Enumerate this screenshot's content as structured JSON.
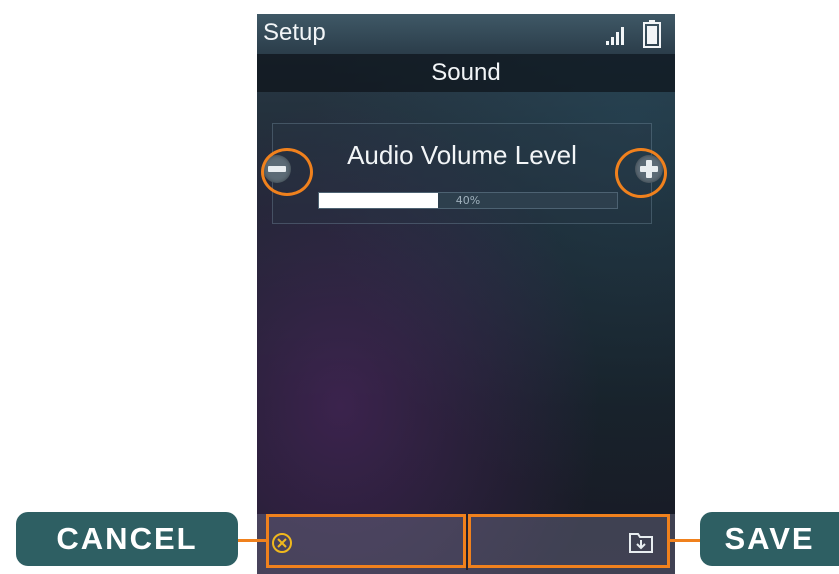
{
  "statusbar": {
    "title": "Setup",
    "signal_icon": "signal-strength-icon",
    "battery_icon": "battery-icon"
  },
  "section": {
    "title": "Sound"
  },
  "volume": {
    "label": "Audio Volume Level",
    "level_text": "40%",
    "level_percent": 40,
    "decrease_icon": "minus-icon",
    "increase_icon": "plus-icon"
  },
  "softkeys": {
    "left_icon": "cancel-icon",
    "right_icon": "save-icon"
  },
  "callouts": {
    "cancel_label": "CANCEL",
    "save_label": "SAVE"
  },
  "colors": {
    "highlight": "#f0811d",
    "callout_bg": "#2e5f63"
  }
}
